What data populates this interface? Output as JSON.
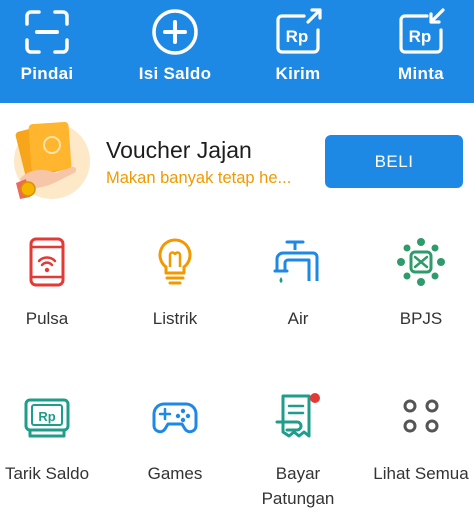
{
  "top_actions": [
    {
      "label": "Pindai",
      "icon": "scan-icon"
    },
    {
      "label": "Isi Saldo",
      "icon": "plus-circle-icon"
    },
    {
      "label": "Kirim",
      "icon": "send-rp-icon"
    },
    {
      "label": "Minta",
      "icon": "request-rp-icon"
    }
  ],
  "banner": {
    "title": "Voucher Jajan",
    "subtitle": "Makan banyak tetap he...",
    "button": "BELI"
  },
  "rp_text": "Rp",
  "services": [
    {
      "label": "Pulsa",
      "icon": "phone-signal-icon"
    },
    {
      "label": "Listrik",
      "icon": "lightbulb-icon"
    },
    {
      "label": "Air",
      "icon": "water-tap-icon"
    },
    {
      "label": "BPJS",
      "icon": "bpjs-icon"
    },
    {
      "label": "Tarik Saldo",
      "icon": "withdraw-cash-icon"
    },
    {
      "label": "Games",
      "icon": "gamepad-icon"
    },
    {
      "label": "Bayar Patungan",
      "line1": "Bayar",
      "line2": "Patungan",
      "icon": "split-bill-icon"
    },
    {
      "label": "Lihat Semua",
      "icon": "grid-dots-icon"
    }
  ],
  "colors": {
    "primary": "#1e88e5",
    "accent_orange": "#f29900",
    "icon_red": "#e53935",
    "icon_teal": "#1e9e8a",
    "icon_blue": "#1e88e5",
    "icon_green": "#2e9b6a"
  }
}
